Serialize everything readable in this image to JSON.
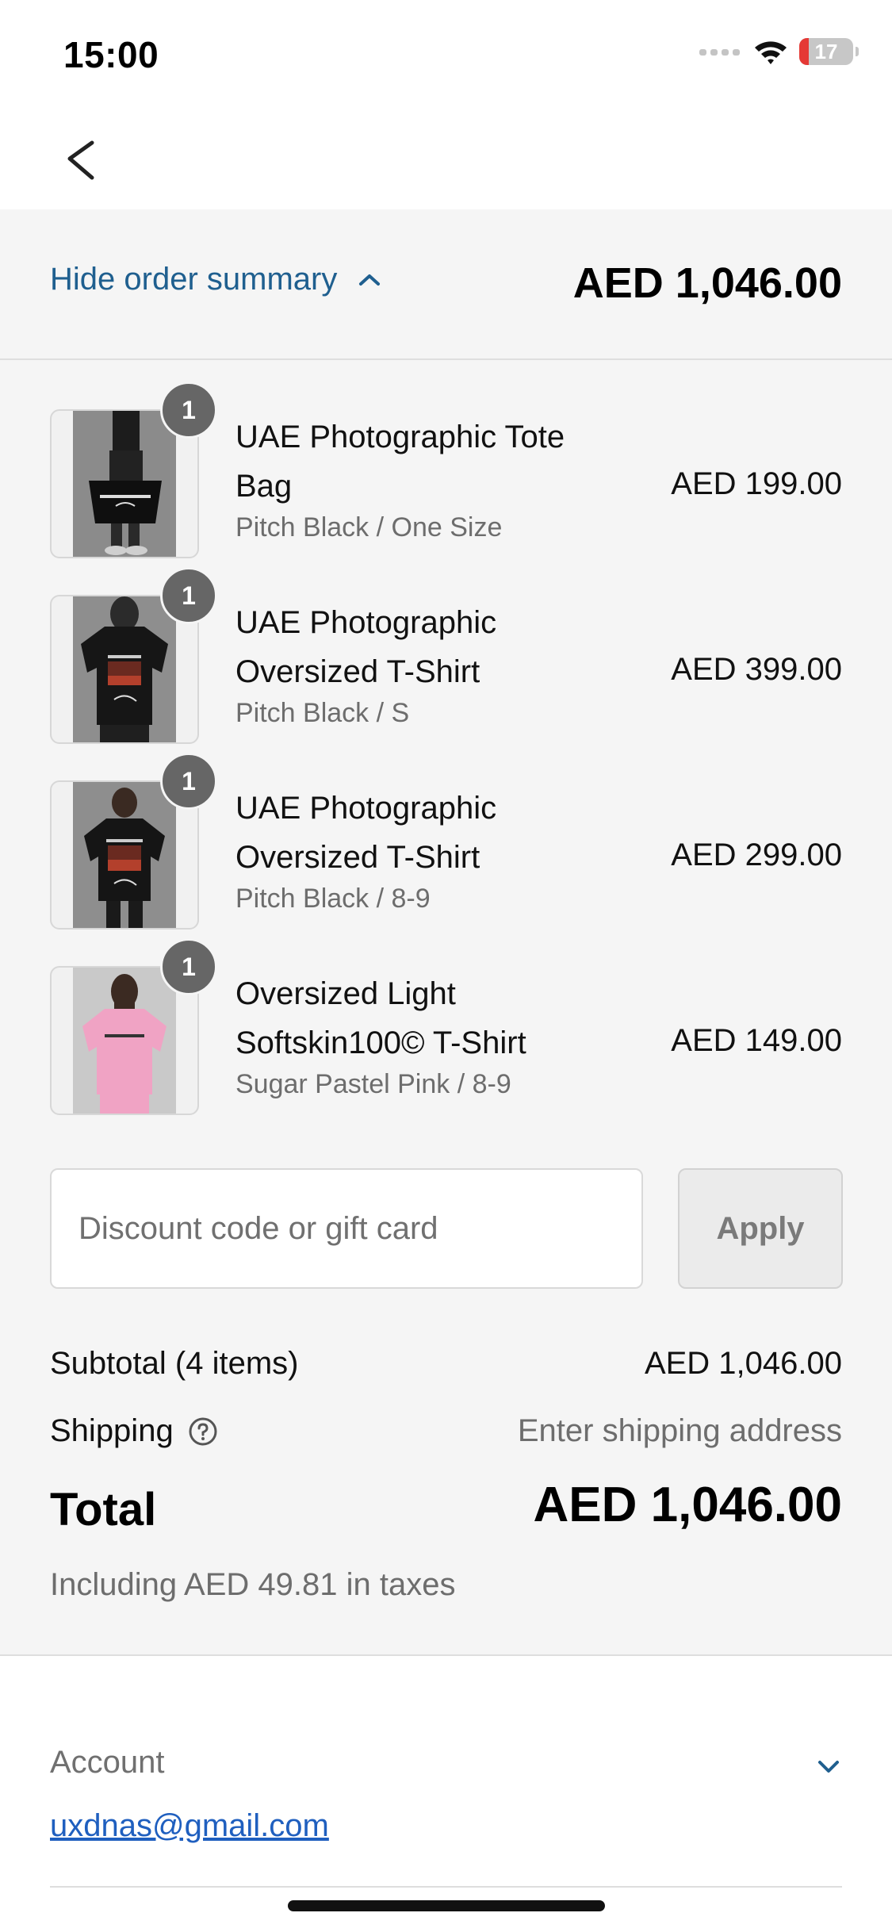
{
  "status_bar": {
    "time": "15:00",
    "battery_level": "17",
    "icons": [
      "cellular-signal-icon",
      "wifi-icon",
      "battery-icon"
    ]
  },
  "header": {
    "back_icon": "chevron-left-icon"
  },
  "summary": {
    "toggle_label": "Hide order summary",
    "toggle_icon": "chevron-up-icon",
    "total": "AED 1,046.00"
  },
  "items": [
    {
      "quantity": "1",
      "title": "UAE Photographic Tote Bag",
      "variant": "Pitch Black / One Size",
      "price": "AED 199.00",
      "image_icon": "tote-bag-photo"
    },
    {
      "quantity": "1",
      "title": "UAE Photographic Oversized T-Shirt",
      "variant": "Pitch Black / S",
      "price": "AED 399.00",
      "image_icon": "black-tshirt-photo"
    },
    {
      "quantity": "1",
      "title": "UAE Photographic Oversized T-Shirt",
      "variant": "Pitch Black / 8-9",
      "price": "AED 299.00",
      "image_icon": "kids-black-tshirt-photo"
    },
    {
      "quantity": "1",
      "title": "Oversized Light Softskin100© T-Shirt",
      "variant": "Sugar Pastel Pink / 8-9",
      "price": "AED 149.00",
      "image_icon": "pink-tshirt-photo"
    }
  ],
  "discount": {
    "placeholder": "Discount code or gift card",
    "value": "",
    "apply_label": "Apply"
  },
  "totals": {
    "subtotal_label": "Subtotal (4 items)",
    "subtotal_value": "AED 1,046.00",
    "shipping_label": "Shipping",
    "shipping_value": "Enter shipping address",
    "total_label": "Total",
    "total_value": "AED 1,046.00",
    "tax_note": "Including AED 49.81 in taxes"
  },
  "account": {
    "label": "Account",
    "email": "uxdnas@gmail.com",
    "toggle_icon": "chevron-down-icon"
  },
  "colors": {
    "link": "#1f5f8f",
    "email_link": "#1f5fbf",
    "panel_bg": "#f5f5f5",
    "badge": "#666666",
    "battery_low": "#e53935"
  }
}
